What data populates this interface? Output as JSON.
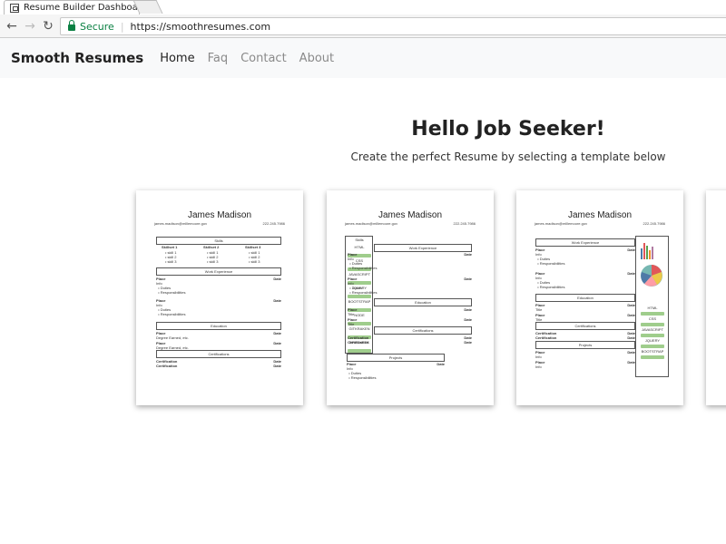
{
  "browser": {
    "tab_title": "Resume Builder Dashboa",
    "secure_label": "Secure",
    "url": "https://smoothresumes.com"
  },
  "navbar": {
    "brand": "Smooth Resumes",
    "links": [
      "Home",
      "Faq",
      "Contact",
      "About"
    ],
    "active": "Home"
  },
  "hero": {
    "title": "Hello Job Seeker!",
    "subtitle": "Create the perfect Resume by selecting a template below"
  },
  "templates": {
    "name": "James Madison",
    "email": "james.madison@mlllemoore.gov",
    "phone": "222.245.7986",
    "sections": {
      "skills": "Skills",
      "work": "Work Experience",
      "education": "Education",
      "certifications": "Certifications",
      "projects": "Projects"
    },
    "skill_cols": [
      "Skillset 1",
      "Skillset 2",
      "Skillset 3"
    ],
    "skill_item": "skill 1",
    "skill_item2": "skill 2",
    "skill_item3": "skill 3",
    "place": "Place",
    "date": "Date",
    "info": "Info",
    "title_label": "Title",
    "duties": "Duties",
    "responsibilities": "Responsibilities",
    "degree": "Degree Earned, etc.",
    "certification": "Certification",
    "sidebar_skills": [
      "HTML",
      "CSS",
      "JAVASCRIPT",
      "JQUERY",
      "BOOTSTRAP",
      "NODE",
      "GITKRAKEN",
      "BRACKETS"
    ],
    "sidebar_skills_3": [
      "HTML",
      "CSS",
      "JAVASCRIPT",
      "JQUERY",
      "BOOTSTRAP"
    ]
  }
}
